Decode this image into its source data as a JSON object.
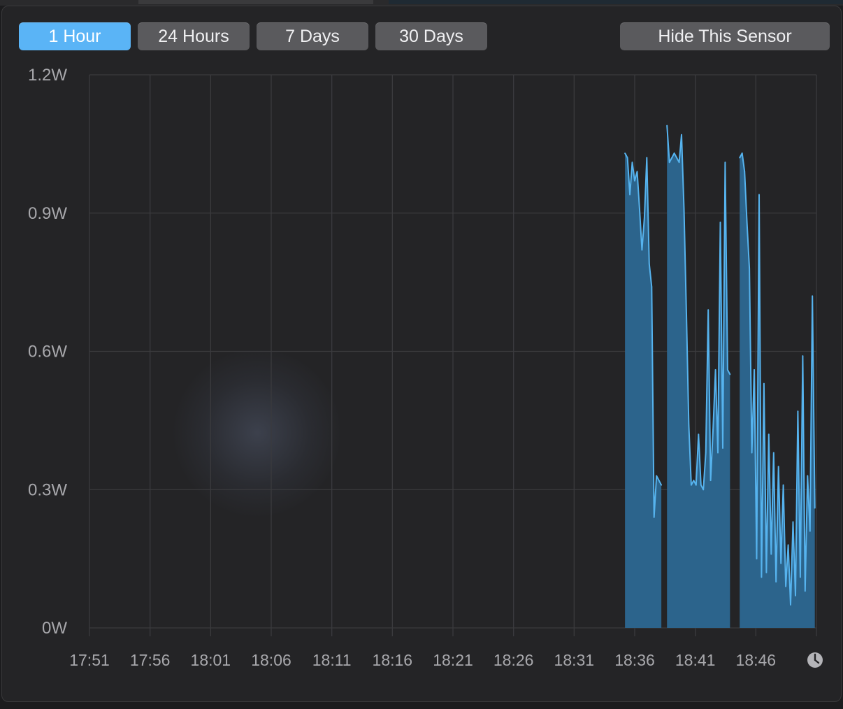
{
  "range_buttons": [
    {
      "label": "1 Hour",
      "active": true
    },
    {
      "label": "24 Hours",
      "active": false
    },
    {
      "label": "7 Days",
      "active": false
    },
    {
      "label": "30 Days",
      "active": false
    }
  ],
  "hide_button": {
    "label": "Hide This Sensor"
  },
  "colors": {
    "accent": "#5ab4f6",
    "fill": "#2c648c",
    "line": "#56b3ee",
    "grid": "#3b3b3e",
    "panel": "#242426"
  },
  "icons": {
    "clock": "clock-icon"
  },
  "chart_data": {
    "type": "area",
    "title": "",
    "xlabel": "",
    "ylabel": "",
    "ylim": [
      0,
      1.2
    ],
    "y_ticks": [
      0,
      0.3,
      0.6,
      0.9,
      1.2
    ],
    "y_tick_labels": [
      "0W",
      "0.3W",
      "0.6W",
      "0.9W",
      "1.2W"
    ],
    "x_ticks": [
      "17:51",
      "17:56",
      "18:01",
      "18:06",
      "18:11",
      "18:16",
      "18:21",
      "18:26",
      "18:31",
      "18:36",
      "18:41",
      "18:46"
    ],
    "x_range": [
      "17:51",
      "18:51"
    ],
    "grid": true,
    "legend": "none",
    "series": [
      {
        "segments": [
          {
            "x": [
              "18:35:12",
              "18:35:24",
              "18:35:36",
              "18:35:48",
              "18:36:00",
              "18:36:12",
              "18:36:24",
              "18:36:36",
              "18:36:48",
              "18:37:00",
              "18:37:12",
              "18:37:24",
              "18:37:36",
              "18:37:48",
              "18:38:00",
              "18:38:12"
            ],
            "values": [
              1.03,
              1.02,
              0.94,
              1.01,
              0.97,
              0.99,
              0.91,
              0.82,
              0.89,
              1.02,
              0.79,
              0.74,
              0.24,
              0.33,
              0.32,
              0.31
            ]
          },
          {
            "x": [
              "18:38:40",
              "18:38:52",
              "18:39:04",
              "18:39:16",
              "18:39:28",
              "18:39:40",
              "18:39:52",
              "18:40:04",
              "18:40:16",
              "18:40:28",
              "18:40:40",
              "18:40:52",
              "18:41:04",
              "18:41:16",
              "18:41:28",
              "18:41:40",
              "18:41:52",
              "18:42:04",
              "18:42:16",
              "18:42:28",
              "18:42:40",
              "18:42:52",
              "18:43:04",
              "18:43:16",
              "18:43:28",
              "18:43:40",
              "18:43:52"
            ],
            "values": [
              1.09,
              1.01,
              1.02,
              1.03,
              1.02,
              1.01,
              1.07,
              0.91,
              0.68,
              0.44,
              0.31,
              0.32,
              0.31,
              0.42,
              0.31,
              0.3,
              0.38,
              0.69,
              0.32,
              0.43,
              0.56,
              0.38,
              0.88,
              0.39,
              1.01,
              0.56,
              0.55
            ]
          },
          {
            "x": [
              "18:44:40",
              "18:44:52",
              "18:45:04",
              "18:45:16",
              "18:45:28",
              "18:45:40",
              "18:45:52",
              "18:46:04",
              "18:46:16",
              "18:46:28",
              "18:46:40",
              "18:46:52",
              "18:47:04",
              "18:47:16",
              "18:47:28",
              "18:47:40",
              "18:47:52",
              "18:48:04",
              "18:48:16",
              "18:48:28",
              "18:48:40",
              "18:48:52",
              "18:49:04",
              "18:49:16",
              "18:49:28",
              "18:49:40",
              "18:49:52",
              "18:50:04",
              "18:50:16",
              "18:50:28",
              "18:50:40",
              "18:50:52"
            ],
            "values": [
              1.02,
              1.03,
              0.99,
              0.88,
              0.78,
              0.38,
              0.56,
              0.15,
              0.94,
              0.11,
              0.53,
              0.12,
              0.42,
              0.16,
              0.38,
              0.1,
              0.35,
              0.14,
              0.31,
              0.09,
              0.18,
              0.05,
              0.23,
              0.07,
              0.47,
              0.11,
              0.59,
              0.08,
              0.33,
              0.21,
              0.72,
              0.26
            ]
          }
        ]
      }
    ]
  }
}
